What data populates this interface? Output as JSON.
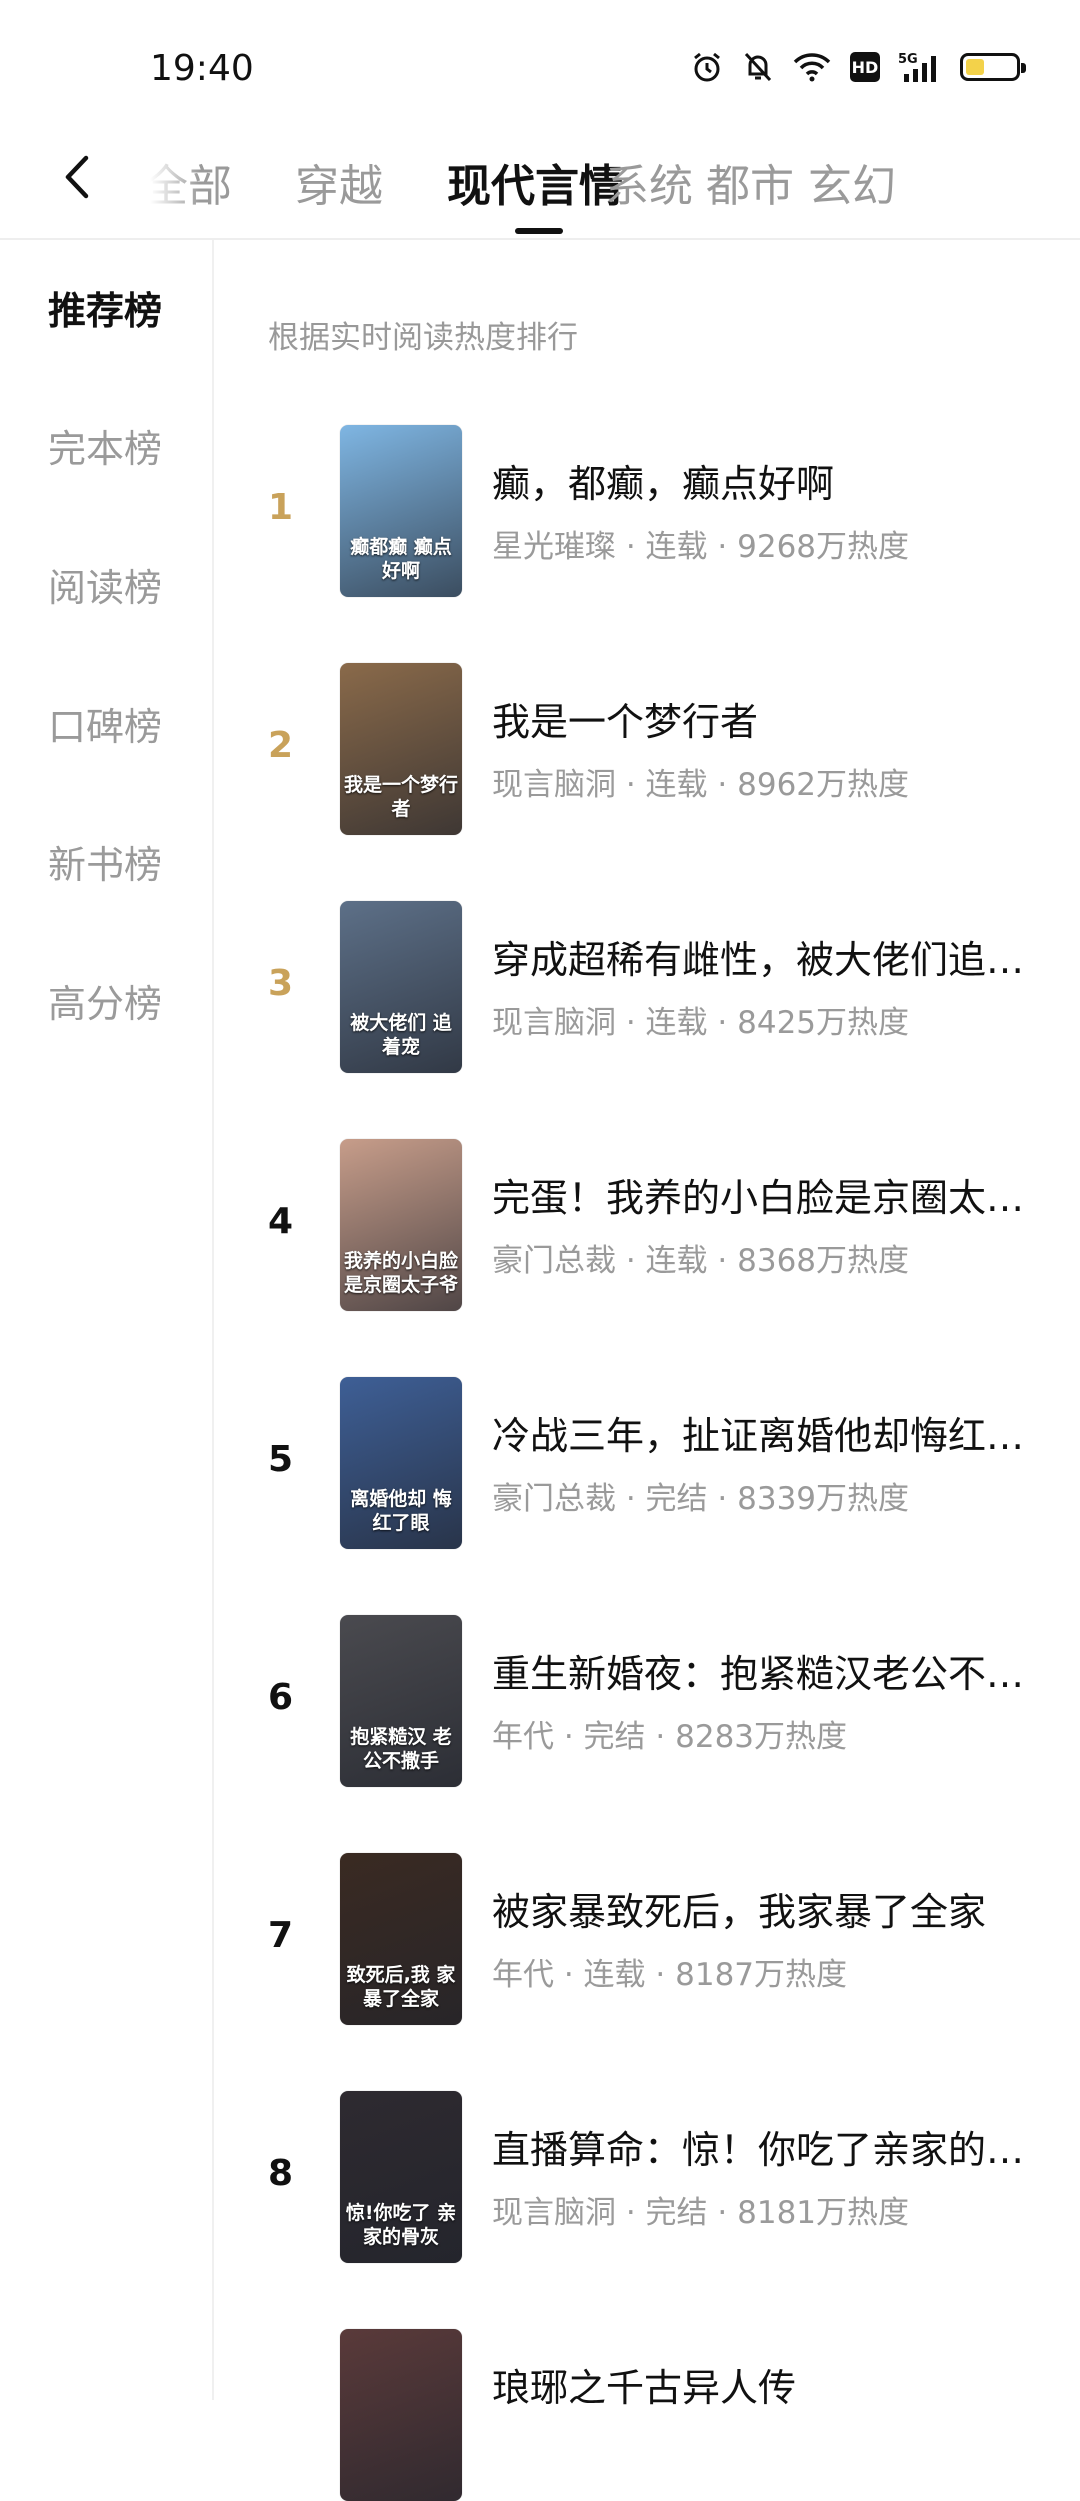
{
  "status_bar": {
    "time": "19:40",
    "hd": "HD",
    "network": "5G"
  },
  "header": {
    "tabs": [
      "全部",
      "穿越",
      "现代言情",
      "系统",
      "都市",
      "玄幻"
    ],
    "active_tab": "现代言情"
  },
  "sidebar": {
    "items": [
      "推荐榜",
      "完本榜",
      "阅读榜",
      "口碑榜",
      "新书榜",
      "高分榜"
    ],
    "active": "推荐榜"
  },
  "list": {
    "hint": "根据实时阅读热度排行",
    "books": [
      {
        "rank": "1",
        "title": "癫，都癫，癫点好啊",
        "meta": "星光璀璨 · 连载 · 9268万热度",
        "cover_text": "癫都癫 癫点好啊",
        "cover_color": "#7fb6e3"
      },
      {
        "rank": "2",
        "title": "我是一个梦行者",
        "meta": "现言脑洞 · 连载 · 8962万热度",
        "cover_text": "我是一个梦行者",
        "cover_color": "#8a6a4a"
      },
      {
        "rank": "3",
        "title": "穿成超稀有雌性，被大佬们追…",
        "meta": "现言脑洞 · 连载 · 8425万热度",
        "cover_text": "被大佬们 追着宠",
        "cover_color": "#5d7088"
      },
      {
        "rank": "4",
        "title": "完蛋！我养的小白脸是京圈太…",
        "meta": "豪门总裁 · 连载 · 8368万热度",
        "cover_text": "我养的小白脸 是京圈太子爷",
        "cover_color": "#c79d8a"
      },
      {
        "rank": "5",
        "title": "冷战三年，扯证离婚他却悔红…",
        "meta": "豪门总裁 · 完结 · 8339万热度",
        "cover_text": "离婚他却 悔红了眼",
        "cover_color": "#3e5f96"
      },
      {
        "rank": "6",
        "title": "重生新婚夜：抱紧糙汉老公不…",
        "meta": "年代 · 完结 · 8283万热度",
        "cover_text": "抱紧糙汉 老公不撒手",
        "cover_color": "#4a4a4f"
      },
      {
        "rank": "7",
        "title": "被家暴致死后，我家暴了全家",
        "meta": "年代 · 连载 · 8187万热度",
        "cover_text": "致死后,我 家暴了全家",
        "cover_color": "#3a2a22"
      },
      {
        "rank": "8",
        "title": "直播算命：惊！你吃了亲家的…",
        "meta": "现言脑洞 · 完结 · 8181万热度",
        "cover_text": "惊!你吃了 亲家的骨灰",
        "cover_color": "#2e2a30"
      },
      {
        "rank": "",
        "title": "琅琊之千古异人传",
        "meta": "",
        "cover_text": "",
        "cover_color": "#5a3a3a"
      }
    ]
  }
}
